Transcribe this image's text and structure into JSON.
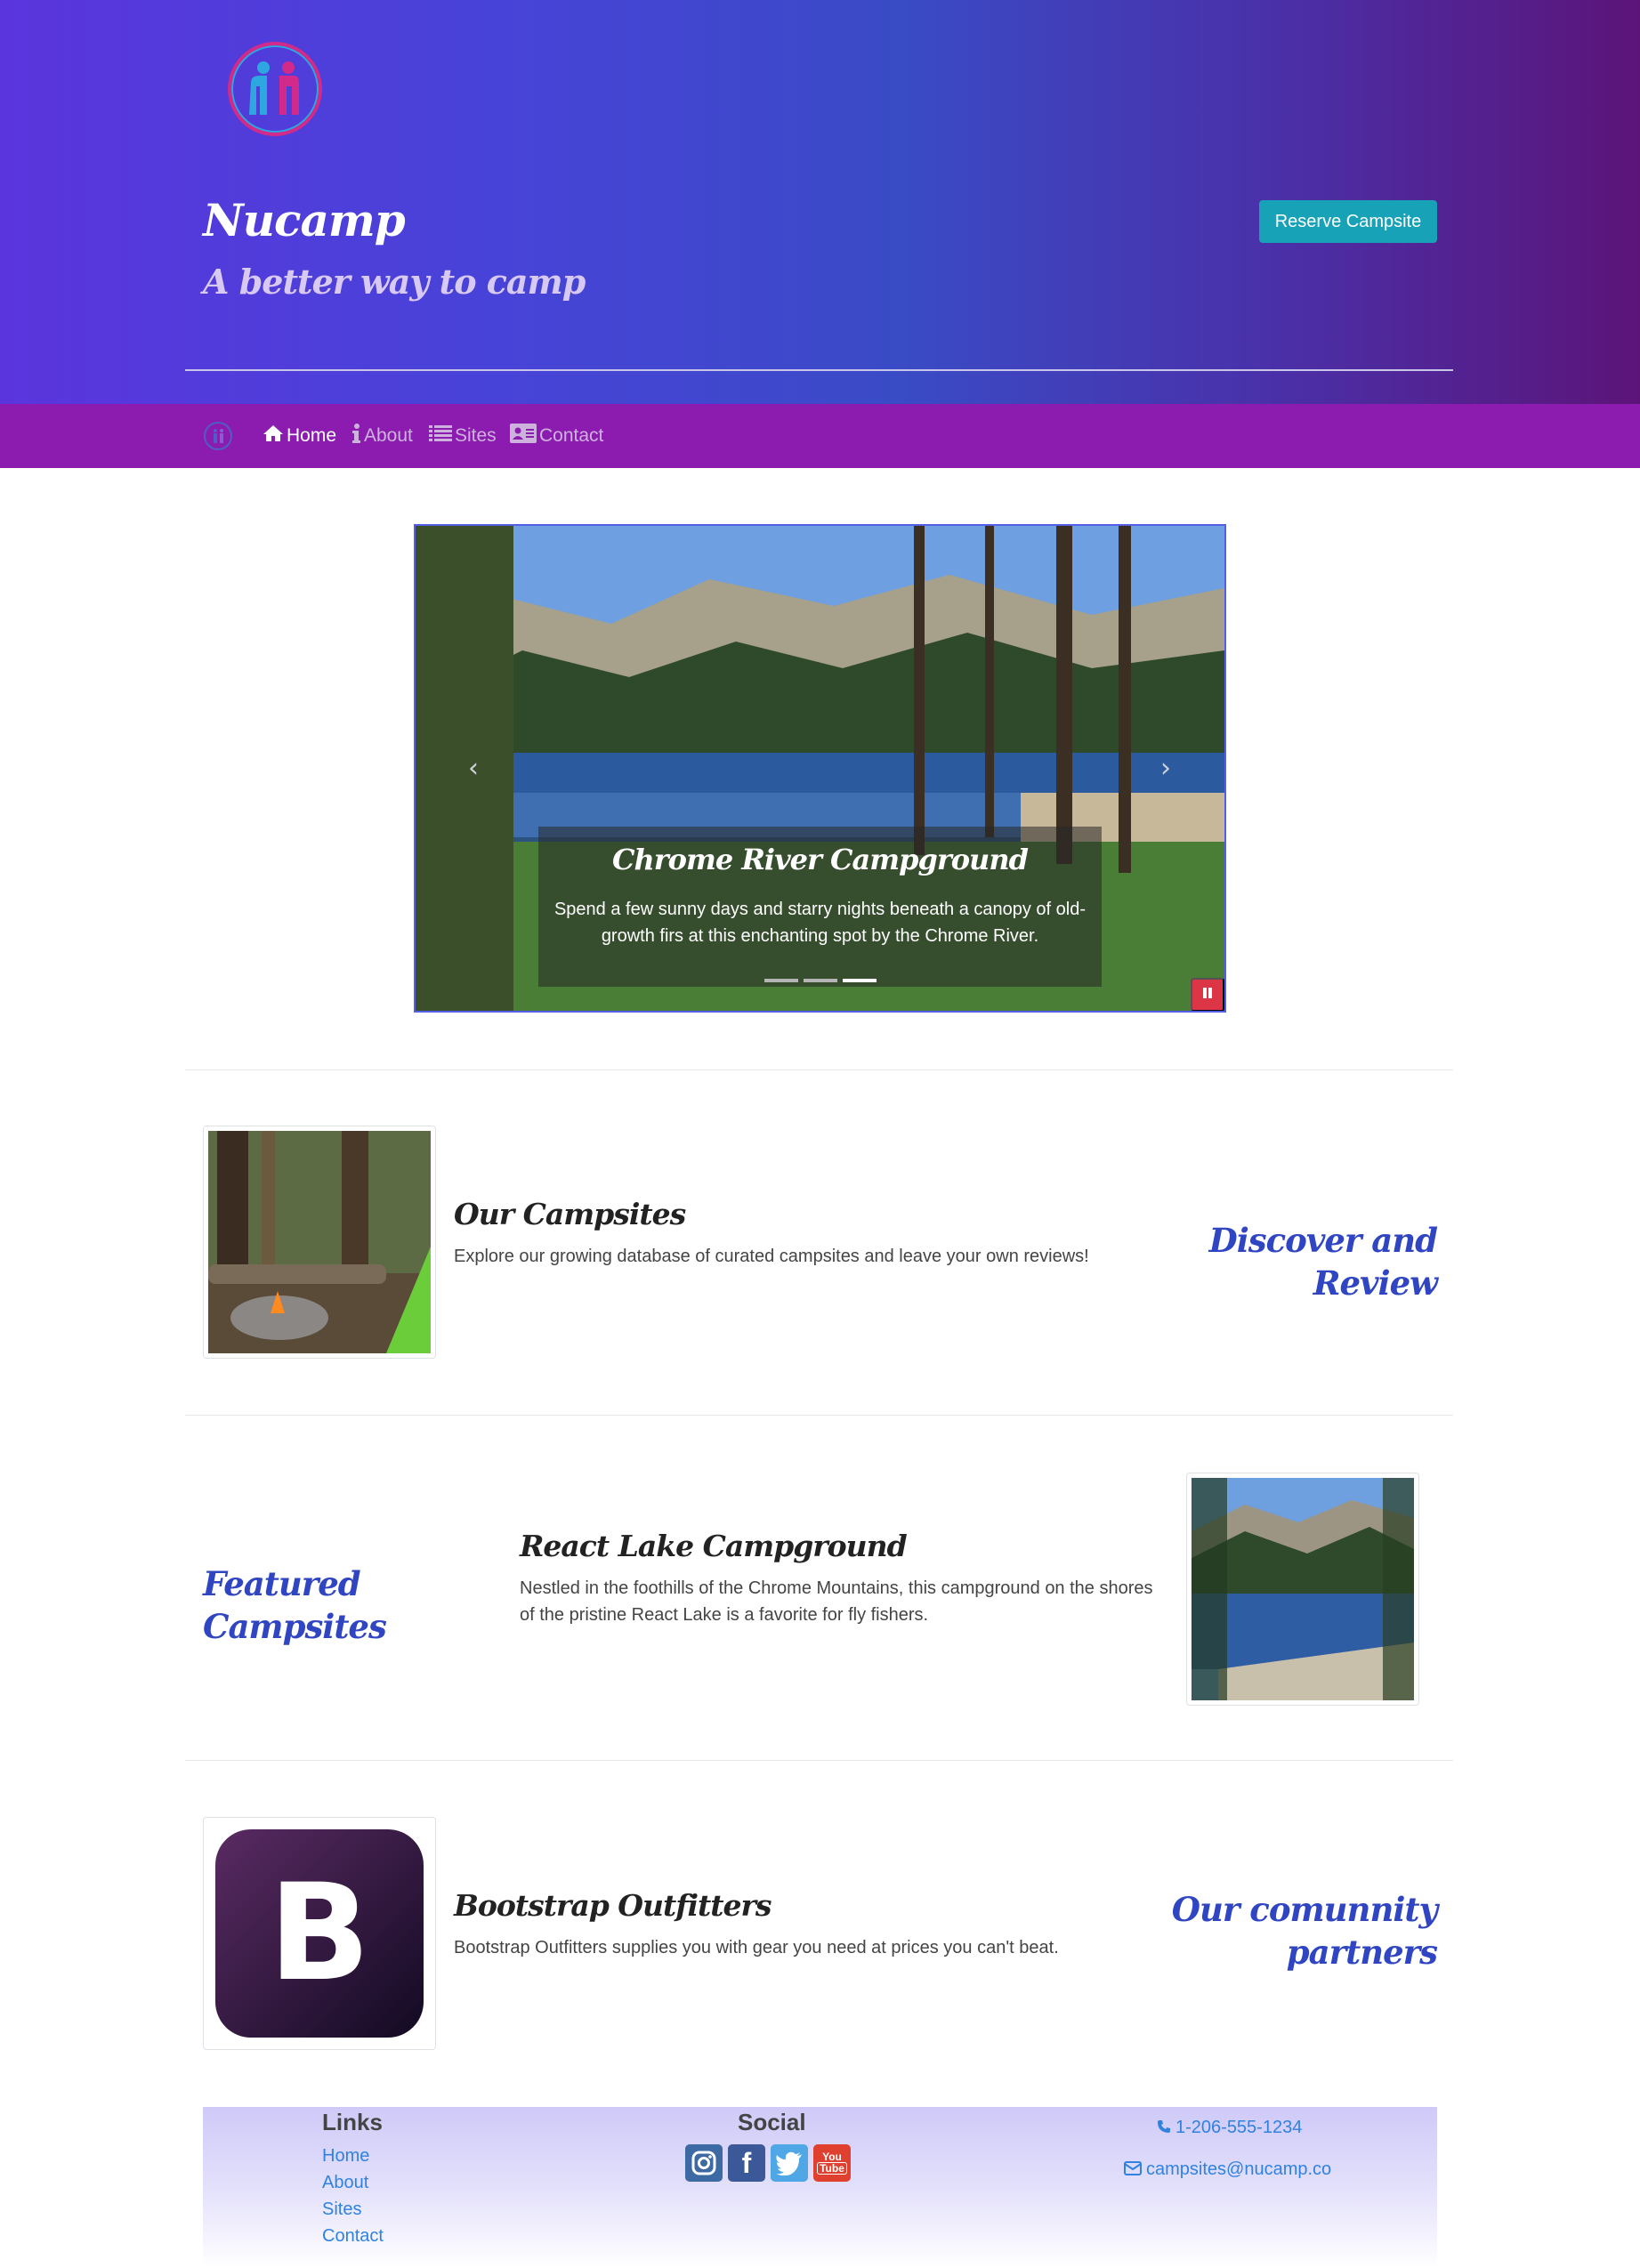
{
  "header": {
    "title": "Nucamp",
    "subtitle": "A better way to camp",
    "reserve_label": "Reserve Campsite"
  },
  "nav": {
    "items": [
      {
        "label": "Home",
        "icon": "home-icon",
        "active": true
      },
      {
        "label": "About",
        "icon": "info-icon",
        "active": false
      },
      {
        "label": "Sites",
        "icon": "list-icon",
        "active": false
      },
      {
        "label": "Contact",
        "icon": "address-card-icon",
        "active": false
      }
    ]
  },
  "carousel": {
    "caption_title": "Chrome River Campground",
    "caption_text": "Spend a few sunny days and starry nights beneath a canopy of old-growth firs at this enchanting spot by the Chrome River.",
    "indicators": 3,
    "active_index": 2
  },
  "sections": [
    {
      "title": "Our Campsites",
      "text": "Explore our growing database of curated campsites and leave your own reviews!",
      "side_heading": "Discover and Review"
    },
    {
      "title": "React Lake Campground",
      "text": "Nestled in the foothills of the Chrome Mountains, this campground on the shores of the pristine React Lake is a favorite for fly fishers.",
      "side_heading": "Featured Campsites"
    },
    {
      "title": "Bootstrap Outfitters",
      "text": "Bootstrap Outfitters supplies you with gear you need at prices you can't beat.",
      "side_heading": "Our comunnity partners",
      "logo_letter": "B"
    }
  ],
  "footer": {
    "links_heading": "Links",
    "links": [
      "Home",
      "About",
      "Sites",
      "Contact"
    ],
    "social_heading": "Social",
    "social_icons": [
      "instagram-icon",
      "facebook-icon",
      "twitter-icon",
      "youtube-icon"
    ],
    "phone": "1-206-555-1234",
    "email": "campsites@nucamp.co"
  },
  "colors": {
    "accent_heading": "#2f45c2",
    "navbar": "#8c1caf",
    "reserve_button": "#17a2b8",
    "link": "#2f82e0",
    "pause_button": "#dc3545"
  }
}
